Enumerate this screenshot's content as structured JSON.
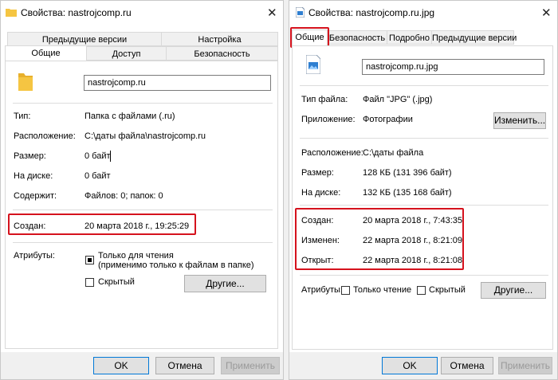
{
  "left": {
    "title": "Свойства: nastrojcomp.ru",
    "tabs_top": [
      "Предыдущие версии",
      "Настройка"
    ],
    "tabs_bottom": [
      "Общие",
      "Доступ",
      "Безопасность"
    ],
    "name_value": "nastrojcomp.ru",
    "props": [
      {
        "label": "Тип:",
        "value": "Папка с файлами (.ru)"
      },
      {
        "label": "Расположение:",
        "value": "C:\\даты файла\\nastrojcomp.ru"
      },
      {
        "label": "Размер:",
        "value": "0 байт"
      },
      {
        "label": "На диске:",
        "value": "0 байт"
      },
      {
        "label": "Содержит:",
        "value": "Файлов: 0; папок: 0"
      }
    ],
    "created_label": "Создан:",
    "created_value": "20 марта 2018 г., 19:25:29",
    "attributes_label": "Атрибуты:",
    "readonly_label_1": "Только для чтения",
    "readonly_label_2": "(применимо только к файлам в папке)",
    "hidden_label": "Скрытый",
    "other_button": "Другие...",
    "ok": "OK",
    "cancel": "Отмена",
    "apply": "Применить"
  },
  "right": {
    "title": "Свойства: nastrojcomp.ru.jpg",
    "tabs": [
      "Общие",
      "Безопасность",
      "Подробно",
      "Предыдущие версии"
    ],
    "name_value": "nastrojcomp.ru.jpg",
    "filetype_label": "Тип файла:",
    "filetype_value": "Файл \"JPG\" (.jpg)",
    "app_label": "Приложение:",
    "app_value": "Фотографии",
    "change_button": "Изменить...",
    "location_label": "Расположение:",
    "location_value": "C:\\даты файла",
    "size_label": "Размер:",
    "size_value": "128 КБ (131 396 байт)",
    "disk_label": "На диске:",
    "disk_value": "132 КБ (135 168 байт)",
    "created_label": "Создан:",
    "created_value": "20 марта 2018 г., 7:43:35",
    "modified_label": "Изменен:",
    "modified_value": "22 марта 2018 г., 8:21:09",
    "opened_label": "Открыт:",
    "opened_value": "22 марта 2018 г., 8:21:08",
    "attributes_label": "Атрибуты:",
    "readonly_label": "Только чтение",
    "hidden_label": "Скрытый",
    "other_button": "Другие...",
    "ok": "OK",
    "cancel": "Отмена",
    "apply": "Применить"
  },
  "colors": {
    "highlight": "#d5121d",
    "folder": "#f5c542",
    "accent": "#0078d7"
  }
}
